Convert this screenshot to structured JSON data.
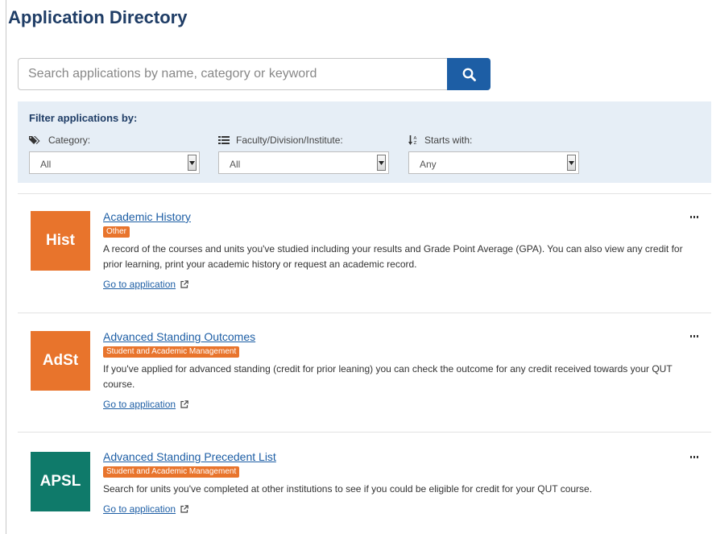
{
  "page": {
    "title": "Application Directory"
  },
  "search": {
    "placeholder": "Search applications by name, category or keyword",
    "button_icon": "search-icon"
  },
  "filters": {
    "heading": "Filter applications by:",
    "category": {
      "label": "Category:",
      "value": "All",
      "icon": "tags-icon"
    },
    "faculty": {
      "label": "Faculty/Division/Institute:",
      "value": "All",
      "icon": "list-icon"
    },
    "starts_with": {
      "label": "Starts with:",
      "value": "Any",
      "icon": "sort-alpha-icon"
    }
  },
  "apps": [
    {
      "abbr": "Hist",
      "color": "#e8742c",
      "title": "Academic History",
      "badge": "Other",
      "description": "A record of the courses and units you've studied including your results and Grade Point Average (GPA). You can also view any credit for prior learning, print your academic history or request an academic record.",
      "link": "Go to application"
    },
    {
      "abbr": "AdSt",
      "color": "#e8742c",
      "title": "Advanced Standing Outcomes",
      "badge": "Student and Academic Management",
      "description": "If you've applied for advanced standing (credit for prior leaning) you can check the outcome for any credit received towards your QUT course.",
      "link": "Go to application"
    },
    {
      "abbr": "APSL",
      "color": "#0f7a6a",
      "title": "Advanced Standing Precedent List",
      "badge": "Student and Academic Management",
      "description": "Search for units you've completed at other institutions to see if you could be eligible for credit for your QUT course.",
      "link": "Go to application"
    }
  ]
}
